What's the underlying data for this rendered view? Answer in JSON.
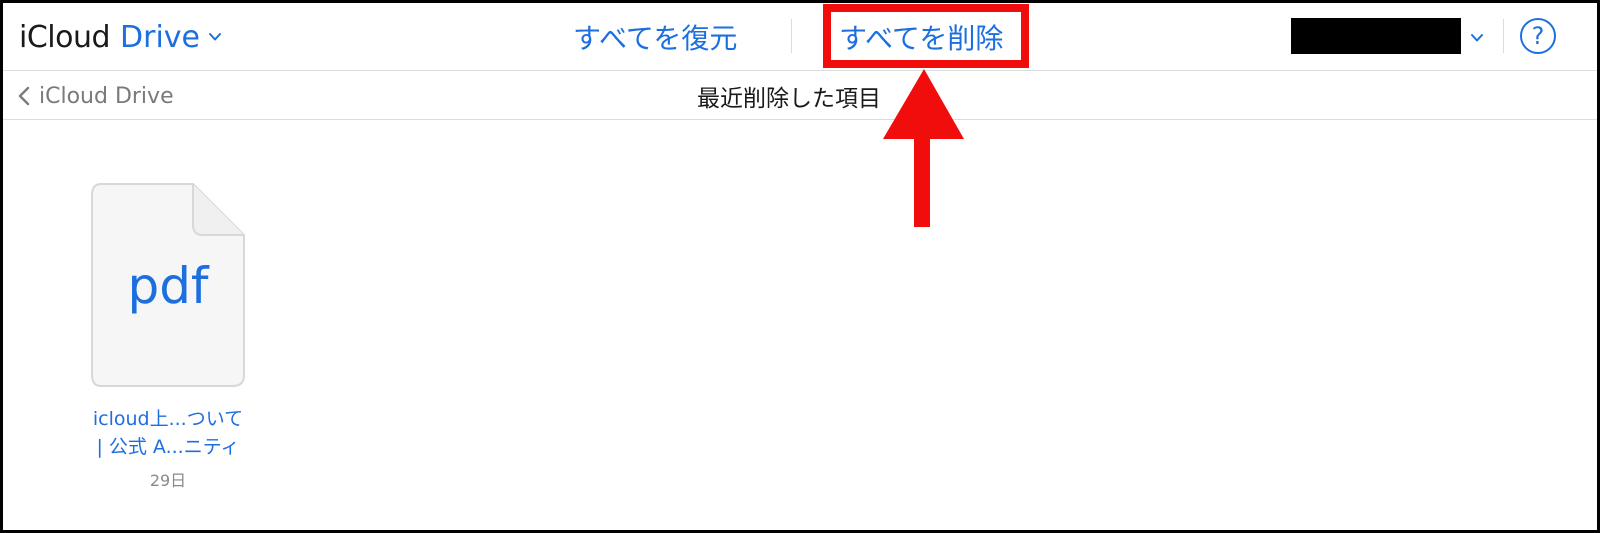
{
  "header": {
    "brand": "iCloud",
    "product": "Drive",
    "restore_all_label": "すべてを復元",
    "delete_all_label": "すべてを削除",
    "help_label": "?"
  },
  "subheader": {
    "back_label": "iCloud Drive",
    "title": "最近削除した項目"
  },
  "files": [
    {
      "ext": "pdf",
      "name_line1": "icloud上...ついて",
      "name_line2": "| 公式 A...ニティ",
      "date": "29日"
    }
  ],
  "colors": {
    "accent": "#1d6fe0",
    "annotation": "#f20d0d",
    "separator": "#dcdcdc"
  },
  "icons": [
    "chevron-down-icon",
    "chevron-left-icon",
    "help-icon",
    "pdf-file-icon",
    "red-arrow-annotation"
  ]
}
